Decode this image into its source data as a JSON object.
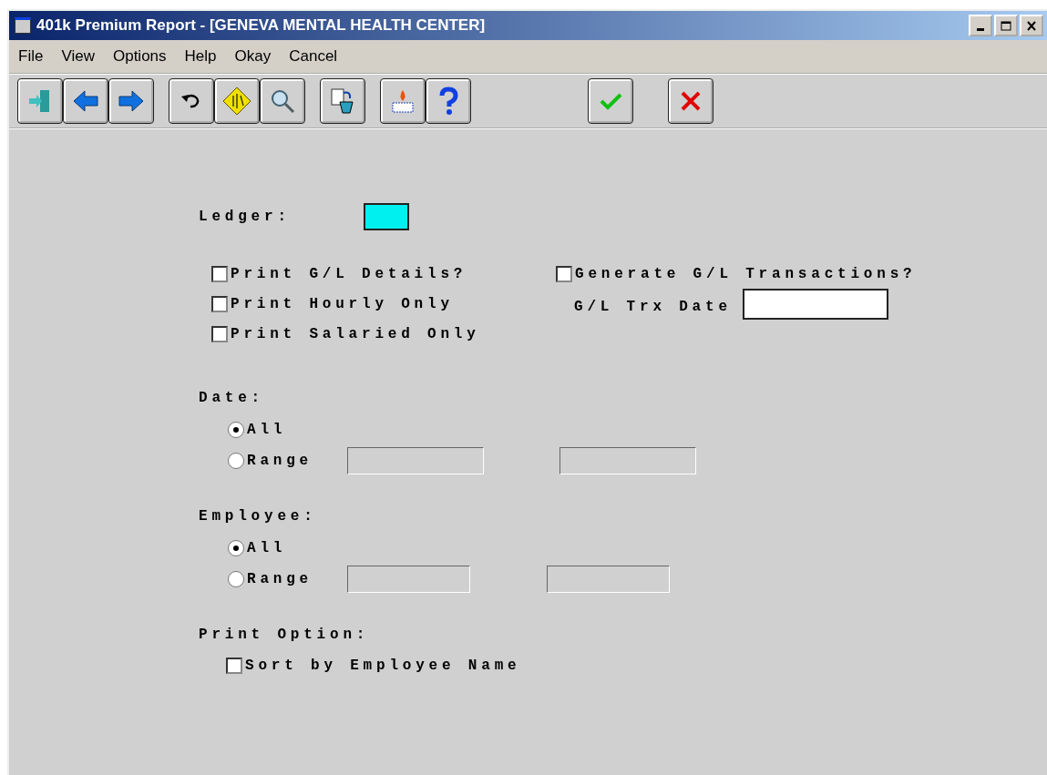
{
  "window": {
    "title": "401k Premium Report - [GENEVA MENTAL HEALTH CENTER]"
  },
  "menu": [
    "File",
    "View",
    "Options",
    "Help",
    "Okay",
    "Cancel"
  ],
  "toolbar": [
    [
      {
        "kind": "exit"
      },
      {
        "kind": "back"
      },
      {
        "kind": "forward"
      }
    ],
    [
      {
        "kind": "undo"
      },
      {
        "kind": "sign"
      },
      {
        "kind": "search"
      }
    ],
    [
      {
        "kind": "copy"
      }
    ],
    [
      {
        "kind": "fire"
      },
      {
        "kind": "help"
      }
    ],
    [
      {
        "kind": "ok"
      }
    ],
    [
      {
        "kind": "cancel"
      }
    ]
  ],
  "form": {
    "ledger": {
      "label": "Ledger:"
    },
    "options": [
      {
        "label": "Print G/L Details?",
        "checked": false
      },
      {
        "label": "Print Hourly Only",
        "checked": false
      },
      {
        "label": "Print Salaried Only",
        "checked": false
      }
    ],
    "generate": {
      "label": "Generate G/L Transactions?",
      "checked": false
    },
    "trx_date": {
      "label": "G/L Trx Date"
    },
    "date": {
      "label": "Date:",
      "choices": [
        {
          "label": "All",
          "selected": true
        },
        {
          "label": "Range",
          "selected": false
        }
      ]
    },
    "employee": {
      "label": "Employee:",
      "choices": [
        {
          "label": "All",
          "selected": true
        },
        {
          "label": "Range",
          "selected": false
        }
      ]
    },
    "print_option": {
      "label": "Print Option:",
      "checkbox": {
        "label": "Sort by Employee Name",
        "checked": false
      }
    }
  }
}
